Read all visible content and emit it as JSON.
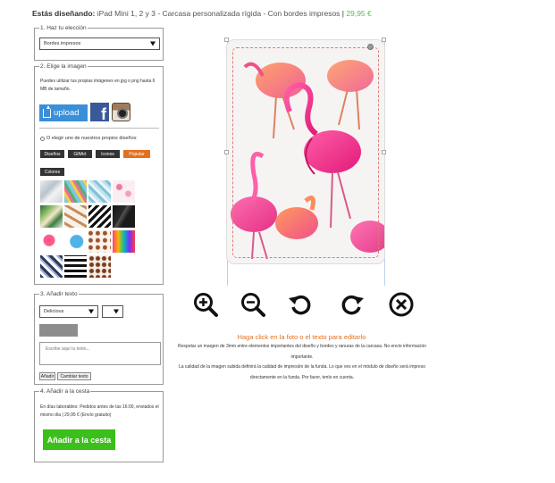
{
  "header": {
    "label": "Estás diseñando:",
    "product": "iPad Mini 1, 2 y 3 - Carcasa personalizada rígida - Con bordes impresos",
    "separator": "|",
    "price": "29,95 €"
  },
  "step1": {
    "legend": "1. Haz tu elección",
    "selected": "Bordes impresos"
  },
  "step2": {
    "legend": "2. Elige la imagen",
    "info": "Puedes utilizar tus propias imágenes en jpg o png hasta 6 MB de tamaño.",
    "upload_label": "upload",
    "facebook_letter": "f",
    "choose_text": "O elegir uno de nuestros propios diseños:",
    "tabs": [
      {
        "label": "Diseños",
        "active": false
      },
      {
        "label": "GiftArt",
        "active": false
      },
      {
        "label": "Iconos",
        "active": false
      },
      {
        "label": "Popular",
        "active": true
      },
      {
        "label": "Colores",
        "active": false
      }
    ]
  },
  "step3": {
    "legend": "3. Añadir texto",
    "font_selected": "Delicious",
    "size_selected": "",
    "placeholder": "Escribe aquí tu texto...",
    "add_label": "Añadir",
    "change_label": "Cambiar texto"
  },
  "step4": {
    "legend": "4. Añadir a la cesta",
    "shipping": "En días laborables: Pedidos antes de las 16:00, enviados el mismo día | 29,95 € (Envío gratuito)",
    "cart_label": "Añadir a la cesta"
  },
  "preview": {
    "hint": "Haga click en la foto o el texto para editarlo",
    "note1": "Respetar un margen de 3mm entre elementos importantes del diseño y bordes y ranuras de la carcasa. No envíe información importante.",
    "note2": "La calidad de la imagen subida definirá la calidad de impresión de la funda. Lo que ves en el módulo de diseño será impreso directamente en la funda. Por favor, tenlo en cuenta."
  },
  "tools": [
    "zoom-in-icon",
    "zoom-out-icon",
    "rotate-left-icon",
    "rotate-right-icon",
    "delete-icon"
  ],
  "colors": {
    "accent": "#e3701e",
    "upload": "#3a8fd9",
    "cart": "#3bbf1a",
    "price": "#5cb85c"
  }
}
